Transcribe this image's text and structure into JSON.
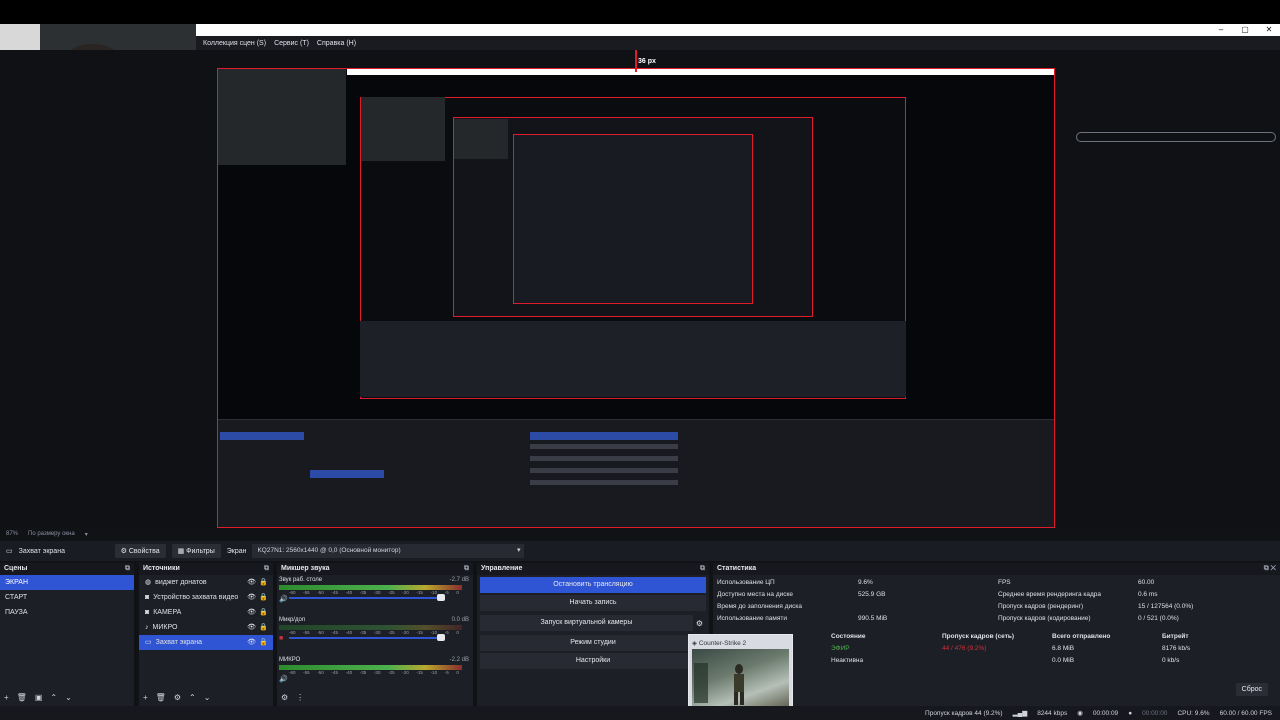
{
  "window_controls": [
    "–",
    "▢",
    "✕"
  ],
  "menu": [
    "Коллекция сцен (S)",
    "Сервис (Т)",
    "Справка (Н)"
  ],
  "preview": {
    "dimension_label": "36 px"
  },
  "zoombar": {
    "zoom": "87%",
    "fit_label": "По размеру окна",
    "chevron": "▾"
  },
  "source_toolbar": {
    "source_name": "Захват экрана",
    "properties_label": "Свойства",
    "filters_label": "Фильтры",
    "screen_label": "Экран",
    "screen_value": "KQ27N1: 2560x1440 @ 0,0 (Основной монитор)"
  },
  "scenes": {
    "title": "Сцены",
    "items": [
      "ЭКРАН",
      "СТАРТ",
      "ПАУЗА"
    ],
    "selected": "ЭКРАН"
  },
  "sources": {
    "title": "Источники",
    "items": [
      {
        "name": "виджет донатов",
        "icon": "globe-icon"
      },
      {
        "name": "Устройство захвата видео",
        "icon": "camera-icon"
      },
      {
        "name": "КАМЕРА",
        "icon": "camera-icon"
      },
      {
        "name": "МИКРО",
        "icon": "mic-icon"
      },
      {
        "name": "Захват экрана",
        "icon": "monitor-icon"
      }
    ],
    "selected": "Захват экрана"
  },
  "mixer": {
    "title": "Микшер звука",
    "channels": [
      {
        "name": "Звук раб. столе",
        "db": "-2.7 dB"
      },
      {
        "name": "Микр/доп",
        "db": "0.0 dB"
      },
      {
        "name": "МИКРО",
        "db": "-2.2 dB"
      }
    ],
    "scale": [
      "-60",
      "-55",
      "-50",
      "-45",
      "-40",
      "-35",
      "-30",
      "-25",
      "-20",
      "-15",
      "-10",
      "-5",
      "0"
    ]
  },
  "controls": {
    "title": "Управление",
    "buttons": [
      "Остановить трансляцию",
      "Начать запись",
      "Запуск виртуальной камеры",
      "Режим студии",
      "Настройки"
    ]
  },
  "stats": {
    "title": "Статистика",
    "left": [
      {
        "label": "Использование ЦП",
        "value": "9.6%"
      },
      {
        "label": "Доступно места на диске",
        "value": "525.9 GB"
      },
      {
        "label": "Время до заполнения диска",
        "value": ""
      },
      {
        "label": "Использование памяти",
        "value": "990.5 MiB"
      }
    ],
    "right": [
      {
        "label": "FPS",
        "value": "60.00"
      },
      {
        "label": "Среднее время рендеринга кадра",
        "value": "0.6 ms"
      },
      {
        "label": "Пропуск кадров (рендеринг)",
        "value": "15 / 127564 (0.0%)"
      },
      {
        "label": "Пропуск кадров (кодирование)",
        "value": "0 / 521 (0.0%)"
      }
    ],
    "table_head": [
      "Состояние",
      "Пропуск кадров (сеть)",
      "Всего отправлено",
      "Битрейт"
    ],
    "rows": [
      {
        "state": "ЭФИР",
        "dropped": "44 / 476 (9.2%)",
        "sent": "6.8 MiB",
        "bitrate": "8176 kb/s"
      },
      {
        "state": "Неактивна",
        "dropped": "",
        "sent": "0.0 MiB",
        "bitrate": "0 kb/s"
      }
    ],
    "reset_label": "Сброс"
  },
  "thumbnail": {
    "title": "Counter-Strike 2"
  },
  "statusbar": {
    "dropped": "Пропуск кадров 44 (9.2%)",
    "bitrate": "8244 kbps",
    "stream_time": "00:00:09",
    "rec_time": "00:00:00",
    "cpu": "CPU: 9.6%",
    "fps": "60.00 / 60.00 FPS"
  },
  "colors": {
    "accent_blue": "#3055d4",
    "selection_red": "#e21b2c",
    "live_green": "#4db24d",
    "dropped_red": "#c8323c"
  }
}
